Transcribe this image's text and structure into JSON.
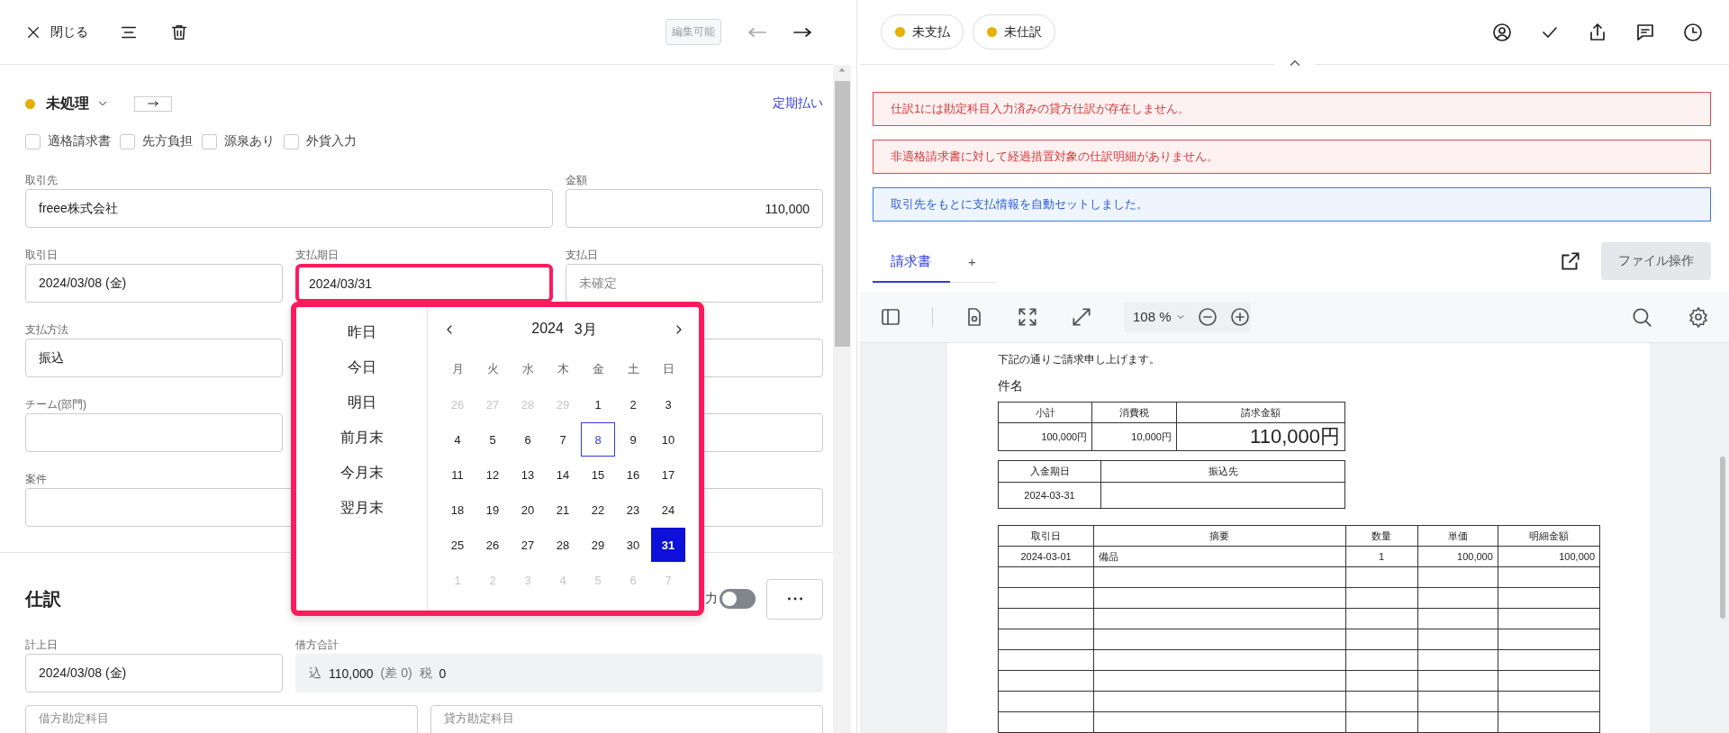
{
  "left": {
    "toolbar": {
      "close": "閉じる",
      "edit_badge": "編集可能",
      "prev_disabled": true
    },
    "status": {
      "label": "未処理",
      "color": "#e6b000"
    },
    "recurring_link": "定期払い",
    "checkboxes": [
      {
        "label": "適格請求書",
        "checked": false
      },
      {
        "label": "先方負担",
        "checked": false
      },
      {
        "label": "源泉あり",
        "checked": false
      },
      {
        "label": "外貨入力",
        "checked": false
      }
    ],
    "rows": [
      {
        "fields": [
          {
            "label": "取引先",
            "value": "freee株式会社",
            "kind": "wide",
            "focused": false
          },
          {
            "label": "金額",
            "value": "110,000",
            "kind": "amount",
            "focused": false
          }
        ]
      },
      {
        "fields": [
          {
            "label": "取引日",
            "value": "2024/03/08 (金)",
            "kind": "normal",
            "focused": false
          },
          {
            "label": "支払期日",
            "value": "2024/03/31",
            "kind": "normal",
            "focused": true
          },
          {
            "label": "支払日",
            "placeholder": "未確定",
            "kind": "normal",
            "focused": false
          }
        ]
      },
      {
        "fields": [
          {
            "label": "支払方法",
            "value": "振込",
            "kind": "normal",
            "focused": false
          },
          {
            "kind": "normal",
            "focused": false
          }
        ]
      },
      {
        "fields": [
          {
            "label": "チーム(部門)",
            "kind": "normal",
            "focused": false
          },
          {
            "kind": "normal",
            "focused": false
          }
        ]
      },
      {
        "fields": [
          {
            "label": "案件",
            "kind": "wide",
            "focused": false
          },
          {
            "kind": "normal",
            "focused": false
          }
        ]
      }
    ],
    "journal": {
      "title": "仕訳",
      "toggle": {
        "label": "力",
        "on": false
      },
      "date": {
        "label": "計上日",
        "value": "2024/03/08 (金)"
      },
      "total": {
        "label": "借方合計",
        "parts": [
          {
            "text": "込",
            "kind": "muted"
          },
          {
            "text": "110,000",
            "kind": "value"
          },
          {
            "text": "(差 0)",
            "kind": "muted"
          },
          {
            "text": "税",
            "kind": "muted"
          },
          {
            "text": "0",
            "kind": "value"
          }
        ]
      },
      "accounts": [
        {
          "placeholder": "借方勘定科目"
        },
        {
          "placeholder": "貸方勘定科目"
        }
      ]
    },
    "datepicker": {
      "presets": [
        "昨日",
        "今日",
        "明日",
        "前月末",
        "今月末",
        "翌月末"
      ],
      "year": "2024",
      "month": "3月",
      "weekdays": [
        "月",
        "火",
        "水",
        "木",
        "金",
        "土",
        "日"
      ],
      "weeks": [
        [
          {
            "label": "26",
            "outside": true,
            "today": false,
            "selected": false
          },
          {
            "label": "27",
            "outside": true,
            "today": false,
            "selected": false
          },
          {
            "label": "28",
            "outside": true,
            "today": false,
            "selected": false
          },
          {
            "label": "29",
            "outside": true,
            "today": false,
            "selected": false
          },
          {
            "label": "1",
            "outside": false,
            "today": false,
            "selected": false
          },
          {
            "label": "2",
            "outside": false,
            "today": false,
            "selected": false
          },
          {
            "label": "3",
            "outside": false,
            "today": false,
            "selected": false
          }
        ],
        [
          {
            "label": "4",
            "outside": false,
            "today": false,
            "selected": false
          },
          {
            "label": "5",
            "outside": false,
            "today": false,
            "selected": false
          },
          {
            "label": "6",
            "outside": false,
            "today": false,
            "selected": false
          },
          {
            "label": "7",
            "outside": false,
            "today": false,
            "selected": false
          },
          {
            "label": "8",
            "outside": false,
            "today": true,
            "selected": false
          },
          {
            "label": "9",
            "outside": false,
            "today": false,
            "selected": false
          },
          {
            "label": "10",
            "outside": false,
            "today": false,
            "selected": false
          }
        ],
        [
          {
            "label": "11",
            "outside": false,
            "today": false,
            "selected": false
          },
          {
            "label": "12",
            "outside": false,
            "today": false,
            "selected": false
          },
          {
            "label": "13",
            "outside": false,
            "today": false,
            "selected": false
          },
          {
            "label": "14",
            "outside": false,
            "today": false,
            "selected": false
          },
          {
            "label": "15",
            "outside": false,
            "today": false,
            "selected": false
          },
          {
            "label": "16",
            "outside": false,
            "today": false,
            "selected": false
          },
          {
            "label": "17",
            "outside": false,
            "today": false,
            "selected": false
          }
        ],
        [
          {
            "label": "18",
            "outside": false,
            "today": false,
            "selected": false
          },
          {
            "label": "19",
            "outside": false,
            "today": false,
            "selected": false
          },
          {
            "label": "20",
            "outside": false,
            "today": false,
            "selected": false
          },
          {
            "label": "21",
            "outside": false,
            "today": false,
            "selected": false
          },
          {
            "label": "22",
            "outside": false,
            "today": false,
            "selected": false
          },
          {
            "label": "23",
            "outside": false,
            "today": false,
            "selected": false
          },
          {
            "label": "24",
            "outside": false,
            "today": false,
            "selected": false
          }
        ],
        [
          {
            "label": "25",
            "outside": false,
            "today": false,
            "selected": false
          },
          {
            "label": "26",
            "outside": false,
            "today": false,
            "selected": false
          },
          {
            "label": "27",
            "outside": false,
            "today": false,
            "selected": false
          },
          {
            "label": "28",
            "outside": false,
            "today": false,
            "selected": false
          },
          {
            "label": "29",
            "outside": false,
            "today": false,
            "selected": false
          },
          {
            "label": "30",
            "outside": false,
            "today": false,
            "selected": false
          },
          {
            "label": "31",
            "outside": false,
            "today": false,
            "selected": true
          }
        ],
        [
          {
            "label": "1",
            "outside": true,
            "today": false,
            "selected": false
          },
          {
            "label": "2",
            "outside": true,
            "today": false,
            "selected": false
          },
          {
            "label": "3",
            "outside": true,
            "today": false,
            "selected": false
          },
          {
            "label": "4",
            "outside": true,
            "today": false,
            "selected": false
          },
          {
            "label": "5",
            "outside": true,
            "today": false,
            "selected": false
          },
          {
            "label": "6",
            "outside": true,
            "today": false,
            "selected": false
          },
          {
            "label": "7",
            "outside": true,
            "today": false,
            "selected": false
          }
        ]
      ]
    }
  },
  "right": {
    "chips": [
      {
        "label": "未支払",
        "color": "#e6b000"
      },
      {
        "label": "未仕訳",
        "color": "#e6b000"
      }
    ],
    "alerts": [
      {
        "kind": "error",
        "text": "仕訳1には勘定科目入力済みの貸方仕訳が存在しません。"
      },
      {
        "kind": "error",
        "text": "非適格請求書に対して経過措置対象の仕訳明細がありません。"
      },
      {
        "kind": "info",
        "text": "取引先をもとに支払情報を自動セットしました。"
      }
    ],
    "tabs": [
      {
        "label": "請求書",
        "selected": true
      },
      {
        "label": "+",
        "selected": false
      }
    ],
    "file_button": "ファイル操作",
    "viewer": {
      "zoom": "108 %"
    },
    "document": {
      "intro": "下記の通りご請求申し上げます。",
      "subject": "件名",
      "summary": {
        "headers": [
          "小計",
          "消費税",
          "請求金額"
        ],
        "values": [
          "100,000円",
          "10,000円",
          "110,000円"
        ]
      },
      "payment": {
        "headers": [
          "入金期日",
          "振込先"
        ],
        "values": [
          "2024-03-31"
        ]
      },
      "items": {
        "headers": [
          "取引日",
          "摘要",
          "数量",
          "単価",
          "明細金額"
        ],
        "rows": [
          [
            "2024-03-01",
            "備品",
            "1",
            "100,000",
            "100,000"
          ]
        ]
      }
    }
  }
}
